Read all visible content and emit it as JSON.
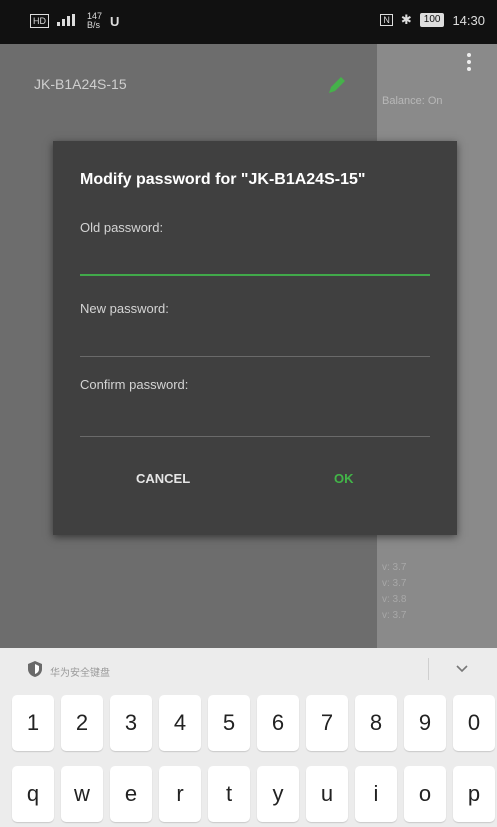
{
  "status_bar": {
    "net_speed_value": "147",
    "net_speed_unit": "B/s",
    "battery": "100",
    "time": "14:30"
  },
  "app": {
    "device_name": "JK-B1A24S-15",
    "balance_label": "Balance: On",
    "cell_values": [
      "v: 3.7",
      "v: 3.7",
      "v: 3.8",
      "v: 3.7"
    ]
  },
  "dialog": {
    "title": "Modify password for \"JK-B1A24S-15\"",
    "old_password_label": "Old password:",
    "old_password_value": "",
    "new_password_label": "New password:",
    "new_password_value": "",
    "confirm_password_label": "Confirm password:",
    "confirm_password_value": "",
    "cancel_label": "CANCEL",
    "ok_label": "OK",
    "accent_color": "#42b548"
  },
  "keyboard": {
    "secure_label": "华为安全键盘",
    "number_row": [
      "1",
      "2",
      "3",
      "4",
      "5",
      "6",
      "7",
      "8",
      "9",
      "0"
    ],
    "letter_row": [
      "q",
      "w",
      "e",
      "r",
      "t",
      "y",
      "u",
      "i",
      "o",
      "p"
    ]
  }
}
